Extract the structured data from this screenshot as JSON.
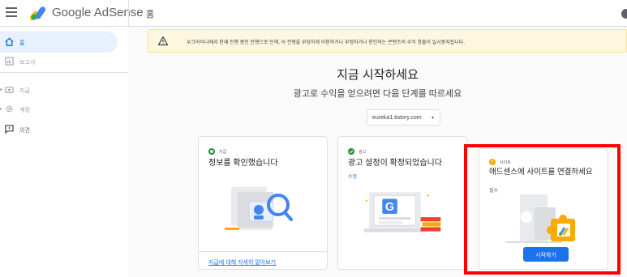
{
  "header": {
    "brand_google": "Google",
    "brand_product": "AdSense",
    "page_title": "홈",
    "menu_icon": "hamburger-menu-icon",
    "logo_icon": "adsense-logo"
  },
  "sidebar": {
    "items": [
      {
        "label": "홈",
        "icon": "home-icon"
      },
      {
        "label": "보고서",
        "icon": "report-icon"
      },
      {
        "label": "지급",
        "icon": "payments-icon"
      },
      {
        "label": "계정",
        "icon": "settings-icon"
      },
      {
        "label": "의견",
        "icon": "feedback-icon"
      }
    ]
  },
  "banner": {
    "icon": "warning-icon",
    "text": "우크라이나에서 현재 진행 중인 전쟁으로 인해, 이 전쟁을 부당하게 이용하거나 부정하거나 용인하는 콘텐츠의 수익 창출이 일시중지됩니다."
  },
  "main": {
    "title": "지금 시작하세요",
    "subtitle": "광고로 수익을 얻으려면 다음 단계를 따르세요",
    "site_select": "eureka1.tistory.com"
  },
  "cards": [
    {
      "tag": "지급",
      "title": "정보를 확인했습니다",
      "link": "지급에 대해 자세히 알아보기"
    },
    {
      "tag": "광고",
      "title": "광고 설정이 확정되었습니다",
      "sub": "수정"
    },
    {
      "tag": "사이트",
      "title": "애드센스에 사이트를 연결하세요",
      "sub": "필수",
      "button": "시작하기"
    }
  ],
  "colors": {
    "accent": "#1a73e8",
    "done": "#1e8e3e",
    "pending": "#f9ab00",
    "highlight": "#ff0000"
  }
}
